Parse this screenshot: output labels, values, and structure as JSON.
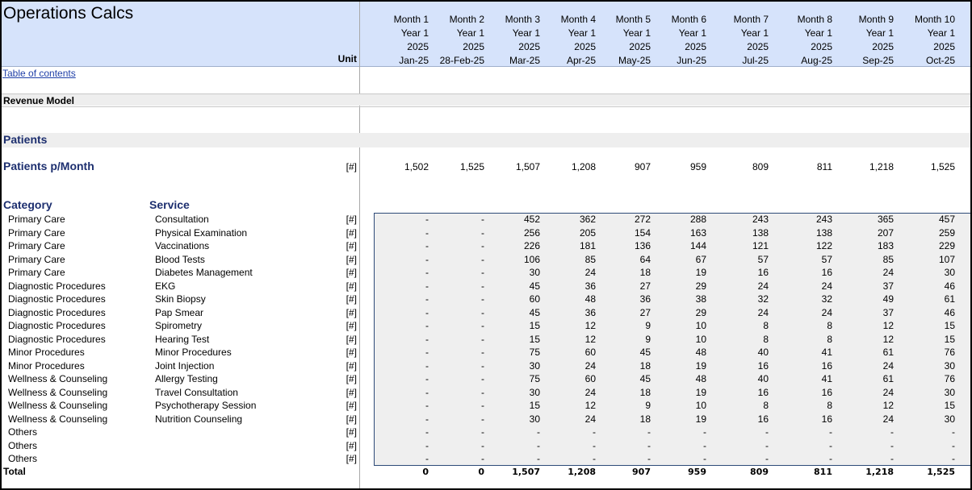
{
  "sheet": {
    "title": "Operations Calcs",
    "unit_header": "Unit",
    "toc_link": "Table of contents",
    "section_label": "Revenue Model"
  },
  "months": [
    {
      "month": "Month 1",
      "year": "Year 1",
      "yyyy": "2025",
      "date": "Jan-25"
    },
    {
      "month": "Month 2",
      "year": "Year 1",
      "yyyy": "2025",
      "date": "28-Feb-25"
    },
    {
      "month": "Month 3",
      "year": "Year 1",
      "yyyy": "2025",
      "date": "Mar-25"
    },
    {
      "month": "Month 4",
      "year": "Year 1",
      "yyyy": "2025",
      "date": "Apr-25"
    },
    {
      "month": "Month 5",
      "year": "Year 1",
      "yyyy": "2025",
      "date": "May-25"
    },
    {
      "month": "Month 6",
      "year": "Year 1",
      "yyyy": "2025",
      "date": "Jun-25"
    },
    {
      "month": "Month 7",
      "year": "Year 1",
      "yyyy": "2025",
      "date": "Jul-25"
    },
    {
      "month": "Month 8",
      "year": "Year 1",
      "yyyy": "2025",
      "date": "Aug-25"
    },
    {
      "month": "Month 9",
      "year": "Year 1",
      "yyyy": "2025",
      "date": "Sep-25"
    },
    {
      "month": "Month 10",
      "year": "Year 1",
      "yyyy": "2025",
      "date": "Oct-25"
    }
  ],
  "patients": {
    "header": "Patients",
    "per_month_label": "Patients p/Month",
    "unit": "[#]",
    "values": [
      "1,502",
      "1,525",
      "1,507",
      "1,208",
      "907",
      "959",
      "809",
      "811",
      "1,218",
      "1,525"
    ]
  },
  "table": {
    "category_header": "Category",
    "service_header": "Service",
    "rows": [
      {
        "category": "Primary Care",
        "service": "Consultation",
        "unit": "[#]",
        "values": [
          "-",
          "-",
          "452",
          "362",
          "272",
          "288",
          "243",
          "243",
          "365",
          "457"
        ]
      },
      {
        "category": "Primary Care",
        "service": "Physical Examination",
        "unit": "[#]",
        "values": [
          "-",
          "-",
          "256",
          "205",
          "154",
          "163",
          "138",
          "138",
          "207",
          "259"
        ]
      },
      {
        "category": "Primary Care",
        "service": "Vaccinations",
        "unit": "[#]",
        "values": [
          "-",
          "-",
          "226",
          "181",
          "136",
          "144",
          "121",
          "122",
          "183",
          "229"
        ]
      },
      {
        "category": "Primary Care",
        "service": "Blood Tests",
        "unit": "[#]",
        "values": [
          "-",
          "-",
          "106",
          "85",
          "64",
          "67",
          "57",
          "57",
          "85",
          "107"
        ]
      },
      {
        "category": "Primary Care",
        "service": "Diabetes Management",
        "unit": "[#]",
        "values": [
          "-",
          "-",
          "30",
          "24",
          "18",
          "19",
          "16",
          "16",
          "24",
          "30"
        ]
      },
      {
        "category": "Diagnostic Procedures",
        "service": "EKG",
        "unit": "[#]",
        "values": [
          "-",
          "-",
          "45",
          "36",
          "27",
          "29",
          "24",
          "24",
          "37",
          "46"
        ]
      },
      {
        "category": "Diagnostic Procedures",
        "service": "Skin Biopsy",
        "unit": "[#]",
        "values": [
          "-",
          "-",
          "60",
          "48",
          "36",
          "38",
          "32",
          "32",
          "49",
          "61"
        ]
      },
      {
        "category": "Diagnostic Procedures",
        "service": "Pap Smear",
        "unit": "[#]",
        "values": [
          "-",
          "-",
          "45",
          "36",
          "27",
          "29",
          "24",
          "24",
          "37",
          "46"
        ]
      },
      {
        "category": "Diagnostic Procedures",
        "service": "Spirometry",
        "unit": "[#]",
        "values": [
          "-",
          "-",
          "15",
          "12",
          "9",
          "10",
          "8",
          "8",
          "12",
          "15"
        ]
      },
      {
        "category": "Diagnostic Procedures",
        "service": "Hearing Test",
        "unit": "[#]",
        "values": [
          "-",
          "-",
          "15",
          "12",
          "9",
          "10",
          "8",
          "8",
          "12",
          "15"
        ]
      },
      {
        "category": "Minor Procedures",
        "service": "Minor Procedures",
        "unit": "[#]",
        "values": [
          "-",
          "-",
          "75",
          "60",
          "45",
          "48",
          "40",
          "41",
          "61",
          "76"
        ]
      },
      {
        "category": "Minor Procedures",
        "service": "Joint Injection",
        "unit": "[#]",
        "values": [
          "-",
          "-",
          "30",
          "24",
          "18",
          "19",
          "16",
          "16",
          "24",
          "30"
        ]
      },
      {
        "category": "Wellness & Counseling",
        "service": "Allergy Testing",
        "unit": "[#]",
        "values": [
          "-",
          "-",
          "75",
          "60",
          "45",
          "48",
          "40",
          "41",
          "61",
          "76"
        ]
      },
      {
        "category": "Wellness & Counseling",
        "service": "Travel Consultation",
        "unit": "[#]",
        "values": [
          "-",
          "-",
          "30",
          "24",
          "18",
          "19",
          "16",
          "16",
          "24",
          "30"
        ]
      },
      {
        "category": "Wellness & Counseling",
        "service": "Psychotherapy Session",
        "unit": "[#]",
        "values": [
          "-",
          "-",
          "15",
          "12",
          "9",
          "10",
          "8",
          "8",
          "12",
          "15"
        ]
      },
      {
        "category": "Wellness & Counseling",
        "service": "Nutrition Counseling",
        "unit": "[#]",
        "values": [
          "-",
          "-",
          "30",
          "24",
          "18",
          "19",
          "16",
          "16",
          "24",
          "30"
        ]
      },
      {
        "category": "Others",
        "service": "",
        "unit": "[#]",
        "values": [
          "-",
          "-",
          "-",
          "-",
          "-",
          "-",
          "-",
          "-",
          "-",
          "-"
        ]
      },
      {
        "category": "Others",
        "service": "",
        "unit": "[#]",
        "values": [
          "-",
          "-",
          "-",
          "-",
          "-",
          "-",
          "-",
          "-",
          "-",
          "-"
        ]
      },
      {
        "category": "Others",
        "service": "",
        "unit": "[#]",
        "values": [
          "-",
          "-",
          "-",
          "-",
          "-",
          "-",
          "-",
          "-",
          "-",
          "-"
        ]
      }
    ],
    "total_label": "Total",
    "totals": [
      "0",
      "0",
      "1,507",
      "1,208",
      "907",
      "959",
      "809",
      "811",
      "1,218",
      "1,525"
    ]
  }
}
